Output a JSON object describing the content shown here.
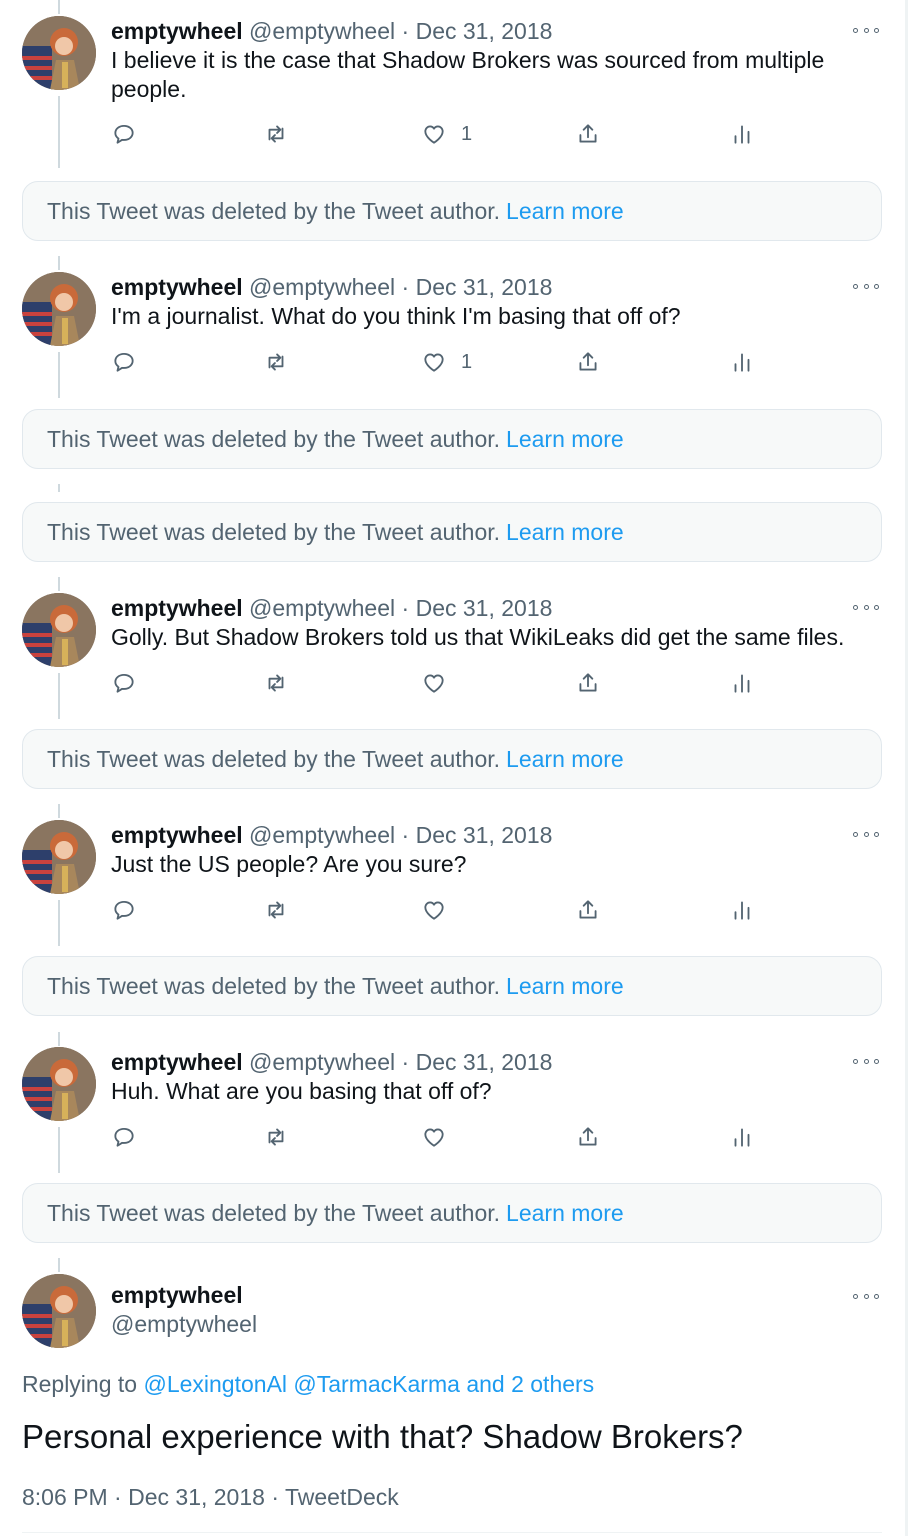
{
  "tweets": [
    {
      "name": "emptywheel",
      "handle": "@emptywheel",
      "sep": "·",
      "date": "Dec 31, 2018",
      "text": "I believe it is the case that Shadow Brokers was sourced from multiple people.",
      "likes": "1"
    },
    {
      "name": "emptywheel",
      "handle": "@emptywheel",
      "sep": "·",
      "date": "Dec 31, 2018",
      "text": "I'm a journalist. What do you think I'm basing that off of?",
      "likes": "1"
    },
    {
      "name": "emptywheel",
      "handle": "@emptywheel",
      "sep": "·",
      "date": "Dec 31, 2018",
      "text": "Golly. But Shadow Brokers told us that WikiLeaks did get the same files.",
      "likes": ""
    },
    {
      "name": "emptywheel",
      "handle": "@emptywheel",
      "sep": "·",
      "date": "Dec 31, 2018",
      "text": "Just the US people? Are you sure?",
      "likes": ""
    },
    {
      "name": "emptywheel",
      "handle": "@emptywheel",
      "sep": "·",
      "date": "Dec 31, 2018",
      "text": "Huh. What are you basing that off of?",
      "likes": ""
    }
  ],
  "deleted_notice": {
    "text": "This Tweet was deleted by the Tweet author.",
    "link": "Learn more"
  },
  "main_tweet": {
    "name": "emptywheel",
    "handle": "@emptywheel",
    "replying_prefix": "Replying to",
    "replying_to_1": "@LexingtonAl",
    "replying_to_2": "@TarmacKarma",
    "replying_others": "and 2 others",
    "text": "Personal experience with that? Shadow Brokers?",
    "time": "8:06 PM",
    "sep": "·",
    "date": "Dec 31, 2018",
    "source": "TweetDeck"
  },
  "icons": [
    "reply-icon",
    "retweet-icon",
    "like-icon",
    "share-icon",
    "analytics-icon",
    "more-icon"
  ],
  "colors": {
    "link": "#1d9bf0",
    "secondary": "#536471",
    "text": "#0f1419",
    "deleted_bg": "#f7f9f9"
  }
}
